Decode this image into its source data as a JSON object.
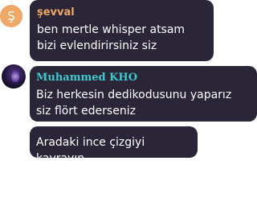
{
  "messages": [
    {
      "avatar_letter": "Ş",
      "author": "şevval",
      "author_color": "#f0a868",
      "text": "ben mertle whisper atsam bizi evlendirirsiniz siz"
    },
    {
      "author": "Muhammed KHO",
      "author_color": "#3ec9cf",
      "text": "Biz herkesin dedikodusunu yaparız siz flört ederseniz"
    },
    {
      "text": "Aradaki ince çizgiyi kavrayın"
    }
  ],
  "colors": {
    "bubble_background": "#2b2538",
    "message_text": "#ffffff"
  }
}
